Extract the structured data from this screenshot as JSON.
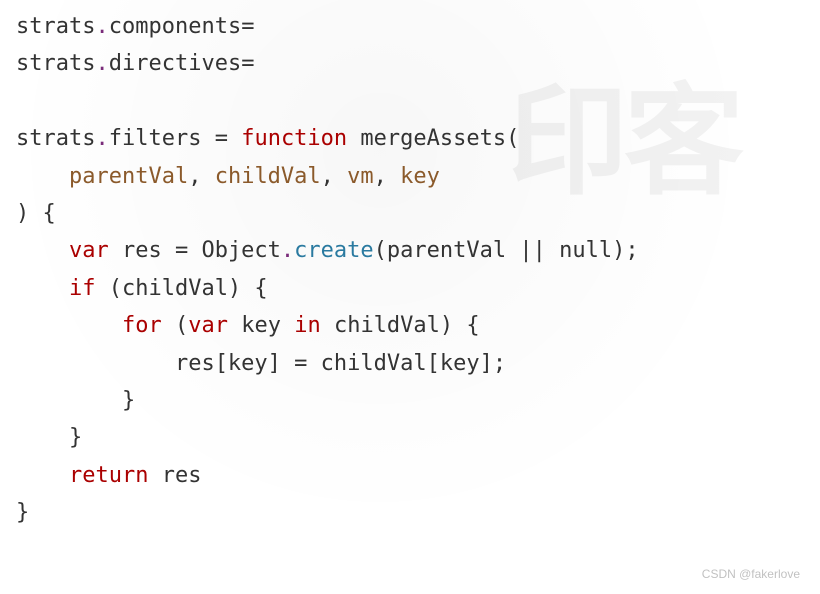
{
  "code": {
    "l1_var": "strats",
    "l1_prop": "components",
    "l1_eq": "=",
    "l2_var": "strats",
    "l2_prop": "directives",
    "l2_eq": "=",
    "l4_var": "strats",
    "l4_prop": "filters",
    "l4_eq": " = ",
    "l4_kw_function": "function",
    "l4_fnname": " mergeAssets(",
    "l5_p1": "parentVal",
    "l5_c1": ", ",
    "l5_p2": "childVal",
    "l5_c2": ", ",
    "l5_p3": "vm",
    "l5_c3": ", ",
    "l5_p4": "key",
    "l6_close": ") {",
    "l7_var_kw": "var",
    "l7_res": " res = Object",
    "l7_create": "create",
    "l7_tail": "(parentVal || null);",
    "l8_if": "if",
    "l8_cond": " (childVal) {",
    "l9_for": "for",
    "l9_open": " (",
    "l9_varkw": "var",
    "l9_key": " key ",
    "l9_in": "in",
    "l9_tail": " childVal) {",
    "l10_body": "res[key] = childVal[key];",
    "l11_close": "}",
    "l12_close": "}",
    "l13_return": "return",
    "l13_res": " res",
    "l14_close": "}"
  },
  "watermark": "印客",
  "credits": "CSDN @fakerlove"
}
